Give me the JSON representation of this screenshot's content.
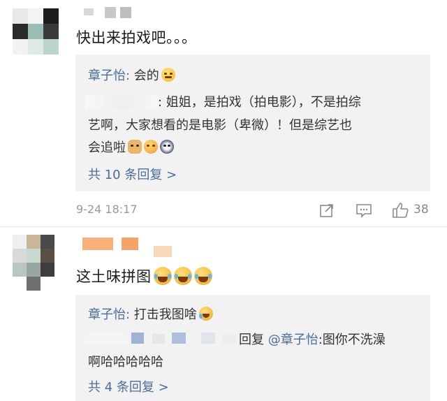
{
  "comments": [
    {
      "text": "快出来拍戏吧。。。",
      "timestamp": "9-24 18:17",
      "like_count": "38",
      "replies": [
        {
          "user": "章子怡",
          "sep": ": ",
          "text": "会的"
        },
        {
          "line1": ": 姐姐，是拍戏（拍电影），不是拍综",
          "line2": "艺啊，大家想看的是电影（卑微）！但是综艺也",
          "line3": "会追啦"
        }
      ],
      "more_label": "共 10 条回复 >"
    },
    {
      "text": "这土味拼图",
      "replies": [
        {
          "user": "章子怡",
          "sep": ": ",
          "text": "打击我图啥"
        },
        {
          "reply_word": "回复 ",
          "mention": "@章子怡",
          "text": ":图你不洗澡",
          "line2": "啊哈哈哈哈哈"
        }
      ],
      "more_label": "共 4 条回复 >"
    }
  ],
  "icons": {
    "share": "share-icon",
    "comment": "comment-icon",
    "like": "thumbs-up-icon"
  },
  "colors": {
    "link": "#4a6e9c",
    "reply_bg": "#f2f2f2",
    "meta": "#999999"
  }
}
